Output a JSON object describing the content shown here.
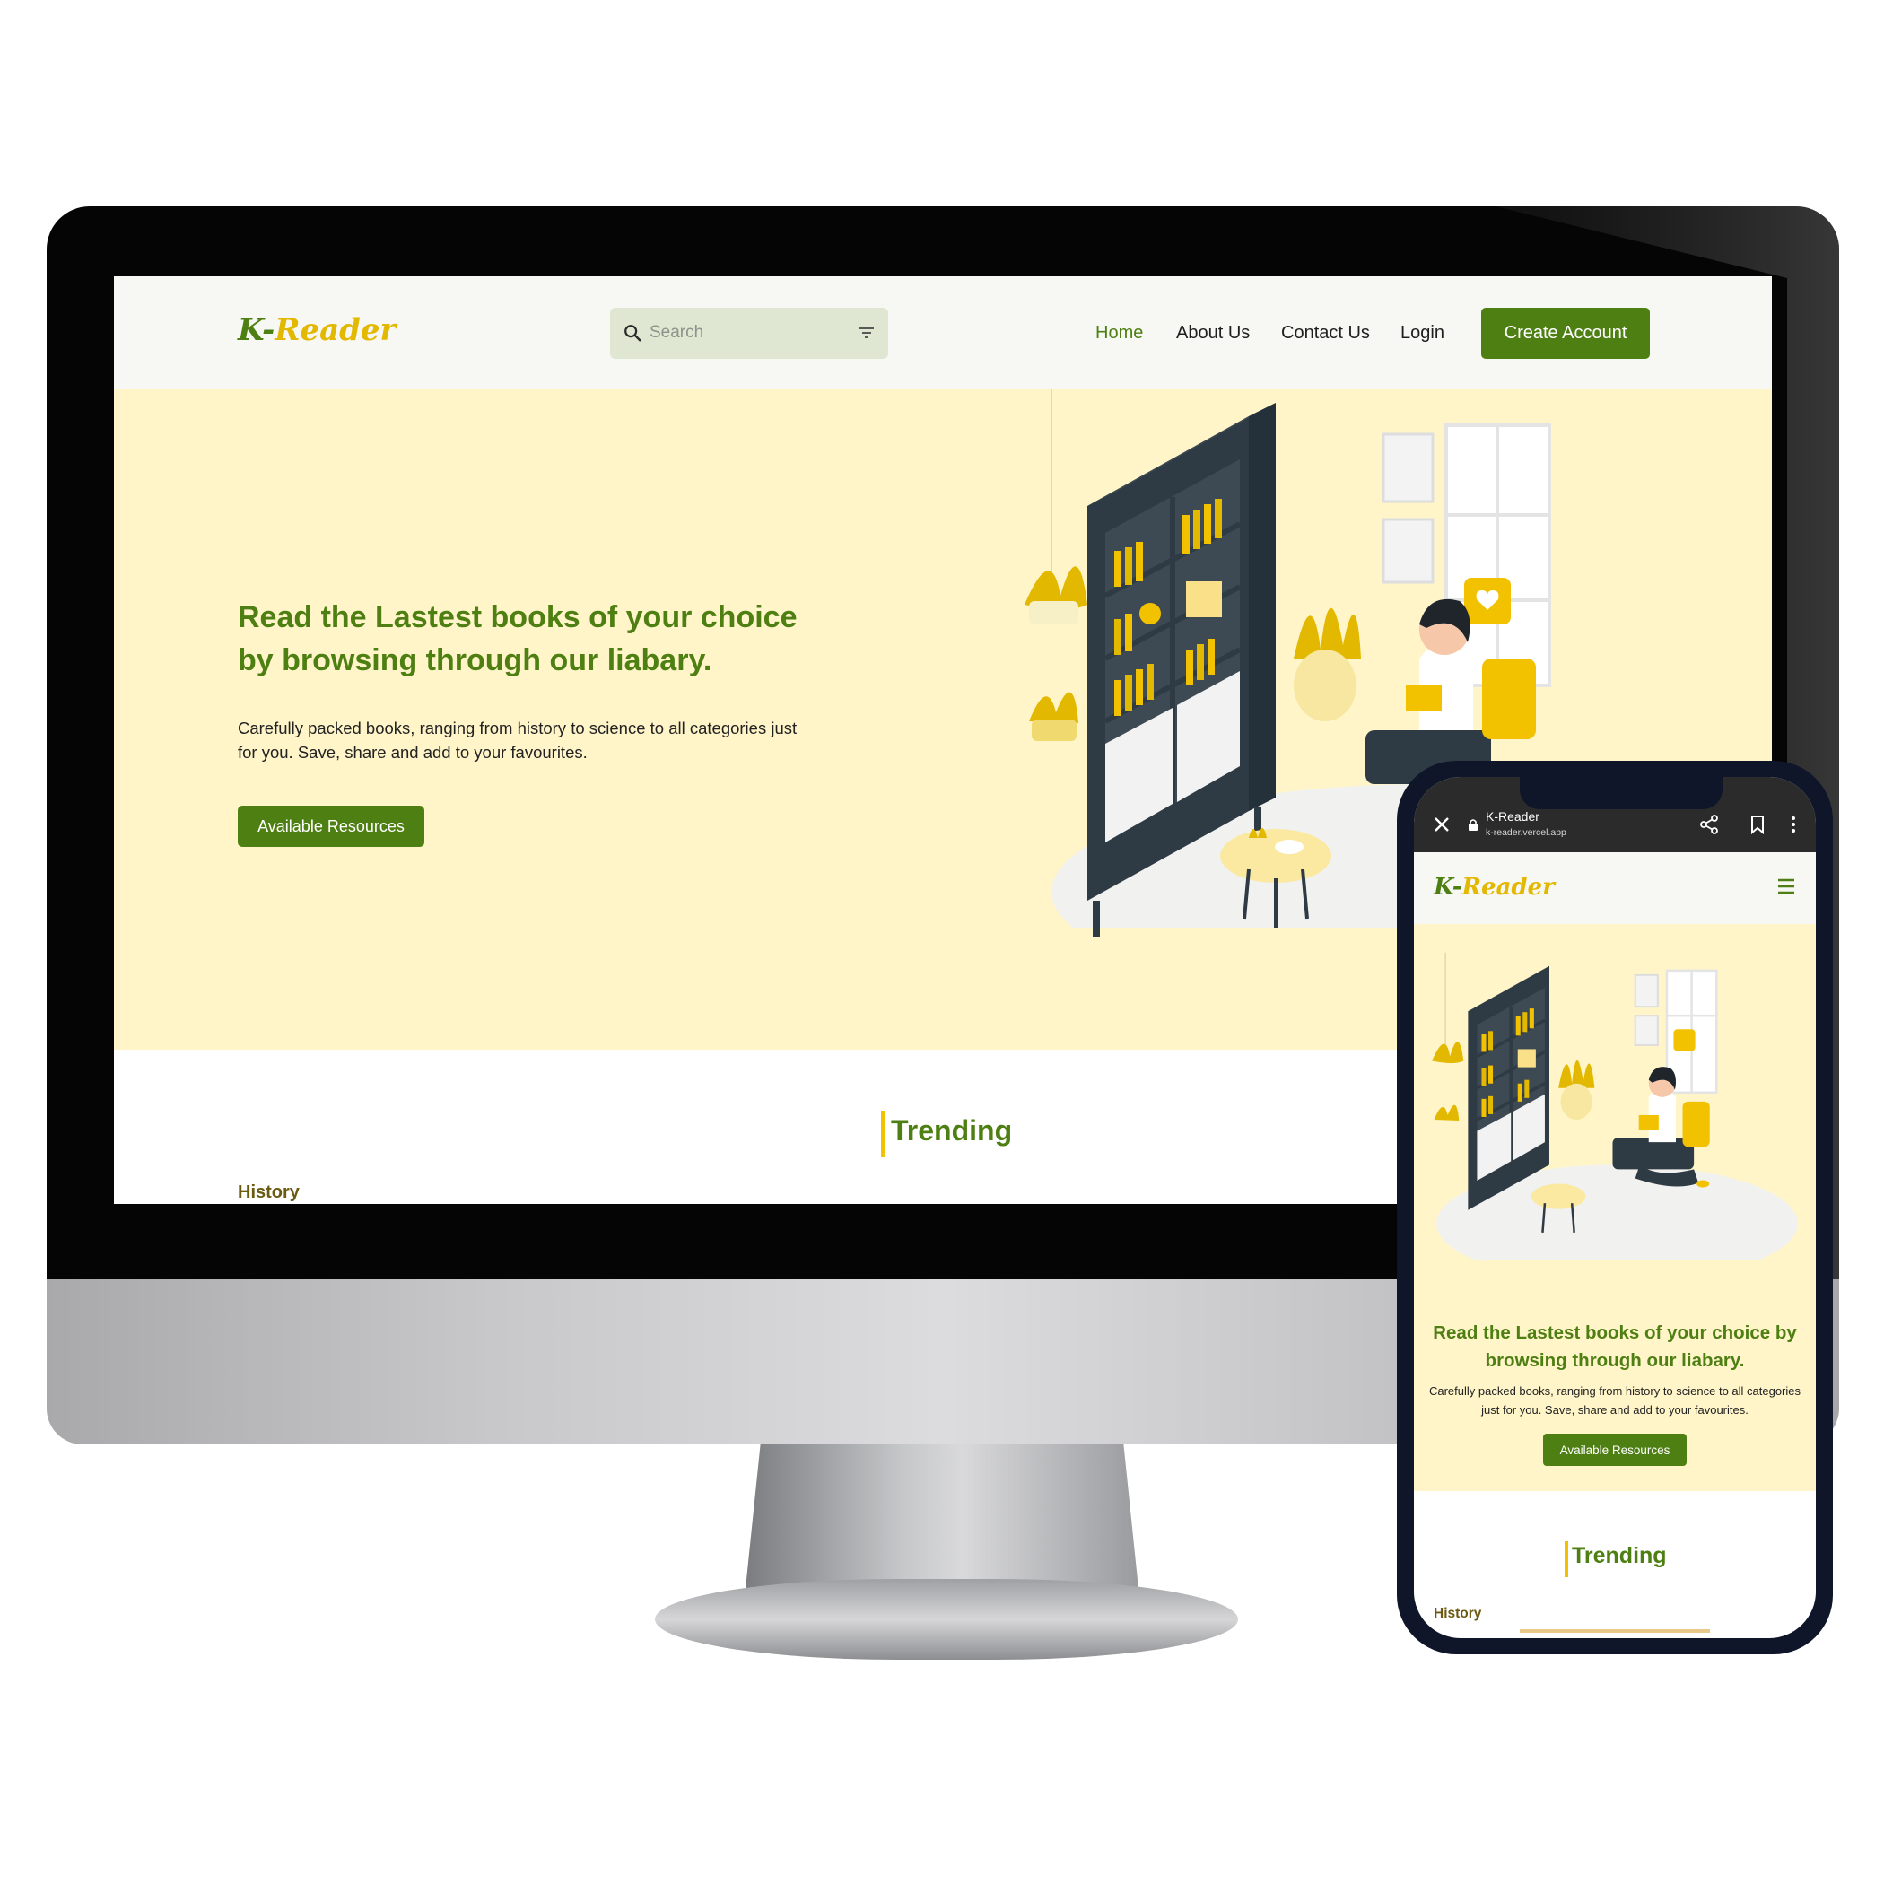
{
  "brand": {
    "logo_k": "K-",
    "logo_rest": "Reader"
  },
  "desktop": {
    "search": {
      "placeholder": "Search"
    },
    "nav": {
      "home": "Home",
      "about": "About Us",
      "contact": "Contact Us",
      "login": "Login",
      "create_account": "Create Account"
    },
    "hero": {
      "title": "Read the Lastest books of your choice by browsing through our liabary.",
      "text": "Carefully packed books, ranging from history to science to all categories just for you. Save, share and add to your favourites.",
      "button": "Available Resources"
    },
    "trending": "Trending",
    "history": "History"
  },
  "mobile": {
    "browser": {
      "title": "K-Reader",
      "url": "k-reader.vercel.app"
    },
    "hero": {
      "title": "Read the Lastest books of your choice by browsing through our liabary.",
      "text": "Carefully packed books, ranging from history to science to all categories just for you. Save, share and add to your favourites.",
      "button": "Available Resources"
    },
    "trending": "Trending",
    "history": "History"
  },
  "icons": {
    "search": "search-icon",
    "filter": "filter-icon",
    "menu": "hamburger-menu-icon",
    "close": "close-icon",
    "lock": "lock-icon",
    "share": "share-icon",
    "bookmark": "bookmark-icon",
    "more": "more-vertical-icon"
  },
  "colors": {
    "brand_green": "#4e7f12",
    "brand_yellow": "#e3b800",
    "hero_bg": "#fff5c9",
    "header_bg": "#f7f7f4",
    "search_bg": "#dfe6d2"
  }
}
